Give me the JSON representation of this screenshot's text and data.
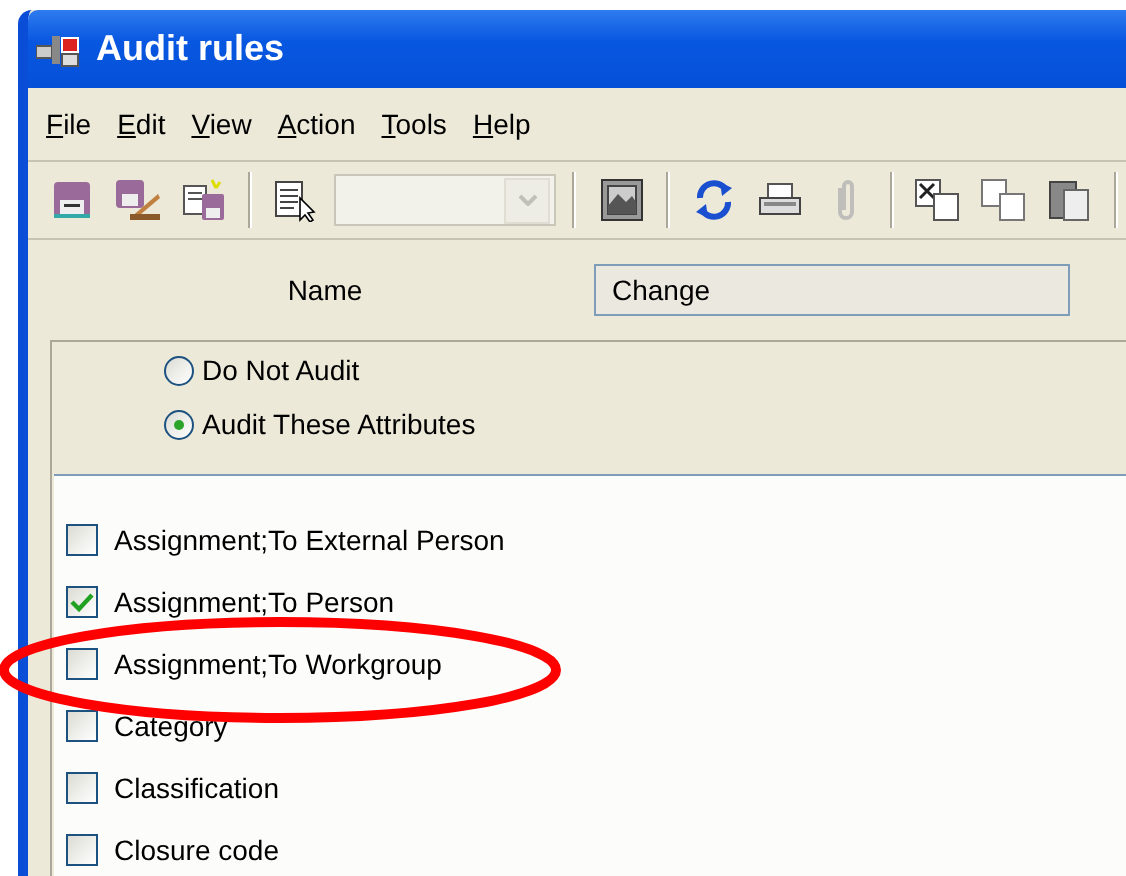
{
  "window": {
    "title": "Audit rules"
  },
  "menu": [
    "File",
    "Edit",
    "View",
    "Action",
    "Tools",
    "Help"
  ],
  "toolbar": [
    {
      "kind": "save",
      "disabled": false
    },
    {
      "kind": "save-edit",
      "disabled": false
    },
    {
      "kind": "import",
      "disabled": false
    },
    {
      "kind": "separator"
    },
    {
      "kind": "notes",
      "disabled": false
    },
    {
      "kind": "dropdown",
      "disabled": true
    },
    {
      "kind": "separator"
    },
    {
      "kind": "image",
      "disabled": false
    },
    {
      "kind": "separator"
    },
    {
      "kind": "refresh",
      "disabled": false
    },
    {
      "kind": "print",
      "disabled": false
    },
    {
      "kind": "attach",
      "disabled": true
    },
    {
      "kind": "separator"
    },
    {
      "kind": "cut",
      "disabled": false
    },
    {
      "kind": "copy",
      "disabled": false
    },
    {
      "kind": "paste",
      "disabled": false
    },
    {
      "kind": "separator"
    }
  ],
  "name_field": {
    "label": "Name",
    "value": "Change"
  },
  "audit_mode": [
    {
      "label": "Do Not Audit",
      "selected": false
    },
    {
      "label": "Audit These Attributes",
      "selected": true
    }
  ],
  "attributes": [
    {
      "label": "Assignment;To External Person",
      "checked": false
    },
    {
      "label": "Assignment;To Person",
      "checked": true
    },
    {
      "label": "Assignment;To Workgroup",
      "checked": false
    },
    {
      "label": "Category",
      "checked": false
    },
    {
      "label": "Classification",
      "checked": false
    },
    {
      "label": "Closure code",
      "checked": false
    }
  ],
  "annotation": {
    "kind": "ellipse"
  }
}
